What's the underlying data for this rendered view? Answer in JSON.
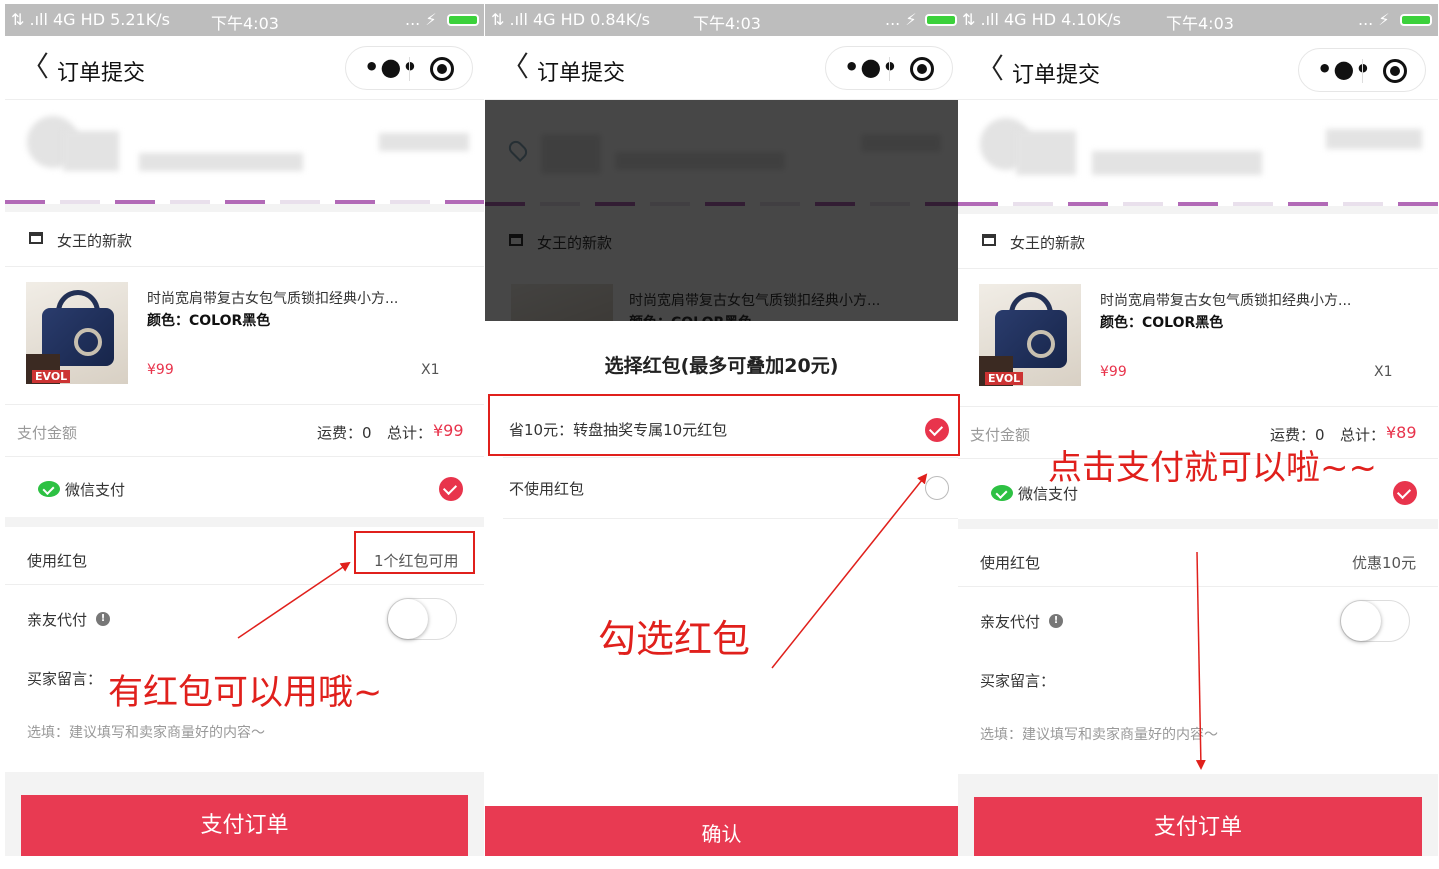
{
  "status": {
    "left": {
      "signal": "⇅ .ıll 4G HD 5.21K/s",
      "time": "下午4:03",
      "extra": "... ⚡"
    },
    "middle": {
      "signal": "⇅ .ıll 4G HD 0.84K/s",
      "time": "下午4:03",
      "extra": "... ⚡"
    },
    "right": {
      "signal": "⇅ .ıll 4G HD 4.10K/s",
      "time": "下午4:03",
      "extra": "... ⚡"
    }
  },
  "nav": {
    "title": "订单提交",
    "back": "〈",
    "more": "•●•"
  },
  "shop": {
    "name": "女王的新款"
  },
  "product": {
    "title": "时尚宽肩带复古女包气质锁扣经典小方...",
    "spec": "颜色：COLOR黑色",
    "price": "¥99",
    "qty": "X1",
    "image_text": "EVOL"
  },
  "payment": {
    "label": "支付金额",
    "shipping": "运费：0",
    "total_label": "总计：",
    "total_before": "¥99",
    "total_after": "¥89",
    "method": "微信支付"
  },
  "redpacket": {
    "label": "使用红包",
    "available": "1个红包可用",
    "discount": "优惠10元"
  },
  "friend_pay": {
    "label": "亲友代付",
    "info": "!"
  },
  "message": {
    "label": "买家留言：",
    "placeholder": "选填：建议填写和卖家商量好的内容～"
  },
  "submit": {
    "label": "支付订单"
  },
  "sheet": {
    "title": "选择红包(最多可叠加20元)",
    "options": [
      "省10元：转盘抽奖专属10元红包",
      "不使用红包"
    ],
    "confirm": "确认"
  },
  "annotations": {
    "a1": "有红包可以用哦~",
    "a2": "勾选红包",
    "a3": "点击支付就可以啦~~"
  },
  "colors": {
    "accent": "#e83a52",
    "annotation": "#e0201c",
    "wechat": "#2dc143"
  }
}
